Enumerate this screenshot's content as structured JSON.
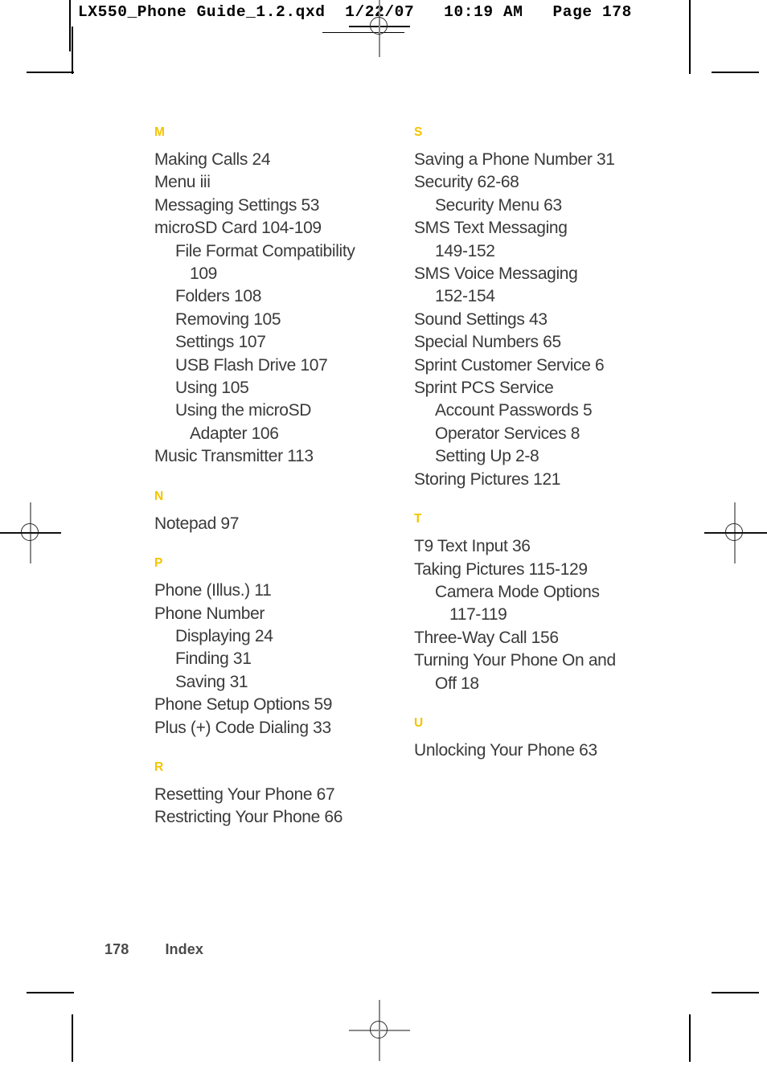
{
  "printer_header": {
    "text": "LX550_Phone Guide_1.2.qxd  1/22/07   10:19 AM   Page 178"
  },
  "footer": {
    "page_number": "178",
    "section_label": "Index"
  },
  "index": {
    "left_column": [
      {
        "letter": "M",
        "entries": [
          {
            "text": "Making Calls 24",
            "level": 1
          },
          {
            "text": "Menu iii",
            "level": 1
          },
          {
            "text": "Messaging Settings 53",
            "level": 1
          },
          {
            "text": "microSD Card 104-109",
            "level": 1
          },
          {
            "text": "File Format Compatibility",
            "level": 2
          },
          {
            "text": "109",
            "level": 3
          },
          {
            "text": "Folders 108",
            "level": 2
          },
          {
            "text": "Removing 105",
            "level": 2
          },
          {
            "text": "Settings 107",
            "level": 2
          },
          {
            "text": "USB Flash Drive 107",
            "level": 2
          },
          {
            "text": "Using 105",
            "level": 2
          },
          {
            "text": "Using the microSD",
            "level": 2
          },
          {
            "text": "Adapter 106",
            "level": 3
          },
          {
            "text": "Music Transmitter 113",
            "level": 1
          }
        ]
      },
      {
        "letter": "N",
        "entries": [
          {
            "text": "Notepad 97",
            "level": 1
          }
        ]
      },
      {
        "letter": "P",
        "entries": [
          {
            "text": "Phone (Illus.) 11",
            "level": 1
          },
          {
            "text": "Phone Number",
            "level": 1
          },
          {
            "text": "Displaying 24",
            "level": 2
          },
          {
            "text": "Finding 31",
            "level": 2
          },
          {
            "text": "Saving 31",
            "level": 2
          },
          {
            "text": "Phone Setup Options 59",
            "level": 1
          },
          {
            "text": "Plus (+) Code Dialing 33",
            "level": 1
          }
        ]
      },
      {
        "letter": "R",
        "entries": [
          {
            "text": "Resetting Your Phone 67",
            "level": 1
          },
          {
            "text": "Restricting Your Phone 66",
            "level": 1
          }
        ]
      }
    ],
    "right_column": [
      {
        "letter": "S",
        "entries": [
          {
            "text": "Saving a Phone Number 31",
            "level": 1
          },
          {
            "text": "Security 62-68",
            "level": 1
          },
          {
            "text": "Security Menu 63",
            "level": 2
          },
          {
            "text": "SMS Text Messaging",
            "level": 1
          },
          {
            "text": "149-152",
            "level": 2
          },
          {
            "text": "SMS Voice Messaging",
            "level": 1
          },
          {
            "text": "152-154",
            "level": 2
          },
          {
            "text": "Sound Settings 43",
            "level": 1
          },
          {
            "text": "Special Numbers 65",
            "level": 1
          },
          {
            "text": "Sprint Customer Service 6",
            "level": 1
          },
          {
            "text": "Sprint PCS Service",
            "level": 1
          },
          {
            "text": "Account Passwords 5",
            "level": 2
          },
          {
            "text": "Operator Services 8",
            "level": 2
          },
          {
            "text": "Setting Up 2-8",
            "level": 2
          },
          {
            "text": "Storing Pictures 121",
            "level": 1
          }
        ]
      },
      {
        "letter": "T",
        "entries": [
          {
            "text": "T9 Text Input 36",
            "level": 1
          },
          {
            "text": "Taking Pictures 115-129",
            "level": 1
          },
          {
            "text": "Camera Mode Options",
            "level": 2
          },
          {
            "text": "117-119",
            "level": 3
          },
          {
            "text": "Three-Way Call 156",
            "level": 1
          },
          {
            "text": "Turning Your Phone On and",
            "level": 1
          },
          {
            "text": "Off 18",
            "level": 2
          }
        ]
      },
      {
        "letter": "U",
        "entries": [
          {
            "text": "Unlocking Your Phone 63",
            "level": 1
          }
        ]
      }
    ]
  },
  "colors": {
    "letter_heading": "#F5C400",
    "body_text": "#3a3a3a",
    "footer_text": "#4a4a4a"
  }
}
